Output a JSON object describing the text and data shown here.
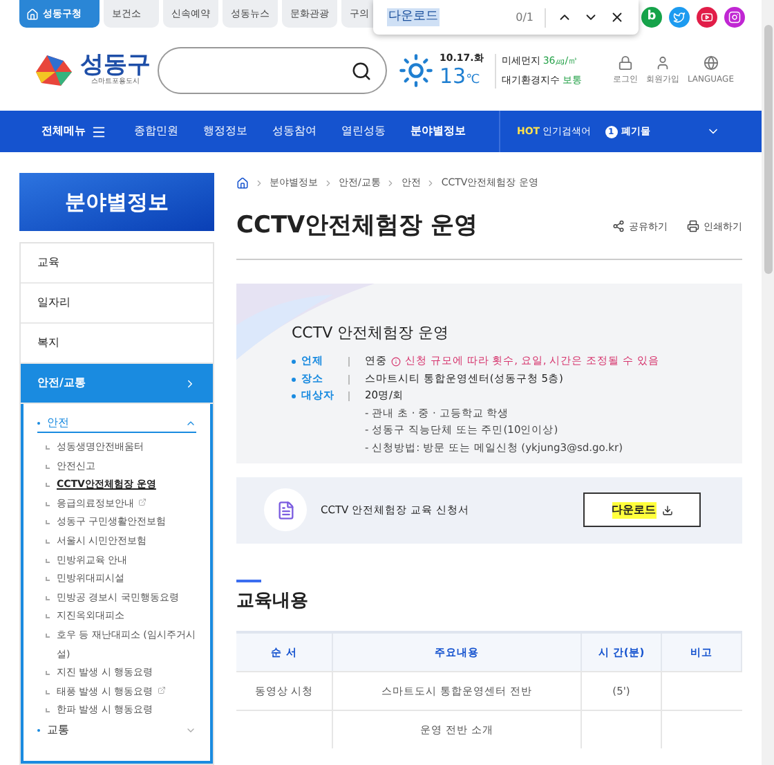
{
  "top_tabs": [
    {
      "label": "성동구청",
      "selected": true
    },
    {
      "label": "보건소",
      "selected": false
    },
    {
      "label": "신속예약",
      "selected": false
    },
    {
      "label": "성동뉴스",
      "selected": false
    },
    {
      "label": "문화관광",
      "selected": false
    },
    {
      "label": "구의",
      "selected": false
    }
  ],
  "find_bar": {
    "value": "다운로드",
    "count": "0/1"
  },
  "social": [
    {
      "kind": "blog",
      "label": "b",
      "color": "#16a34a"
    },
    {
      "kind": "twitter",
      "color": "#1d9bf0"
    },
    {
      "kind": "youtube",
      "color": "#e11d48"
    },
    {
      "kind": "instagram",
      "color": "#c026d3"
    }
  ],
  "header": {
    "logo": "성동구",
    "slogan": "스마트포용도시",
    "date": "10.17.화",
    "temp": "13",
    "unit": "℃",
    "dust_label": "미세먼지",
    "dust_value": "36㎍/㎥",
    "air_label": "대기환경지수",
    "air_value": "보통",
    "utils": [
      {
        "kind": "lock",
        "label": "로그인"
      },
      {
        "kind": "user",
        "label": "회원가입"
      },
      {
        "kind": "globe",
        "label": "LANGUAGE"
      }
    ]
  },
  "nav": {
    "all_menu": "전체메뉴",
    "items": [
      {
        "label": "종합민원",
        "selected": false
      },
      {
        "label": "행정정보",
        "selected": false
      },
      {
        "label": "성동참여",
        "selected": false
      },
      {
        "label": "열린성동",
        "selected": false
      },
      {
        "label": "분야별정보",
        "selected": true
      }
    ],
    "hot": "HOT",
    "hot_label": "인기검색어",
    "rank": "1",
    "keyword": "폐기물"
  },
  "sidebar": {
    "title": "분야별정보",
    "items": [
      {
        "label": "교육",
        "selected": false
      },
      {
        "label": "일자리",
        "selected": false
      },
      {
        "label": "복지",
        "selected": false
      },
      {
        "label": "안전/교통",
        "selected": true
      }
    ],
    "groups": [
      {
        "label": "안전",
        "expanded": true,
        "children": [
          {
            "label": "성동생명안전배움터",
            "selected": false,
            "external": false
          },
          {
            "label": "안전신고",
            "selected": false,
            "external": false
          },
          {
            "label": "CCTV안전체험장 운영",
            "selected": true,
            "external": false
          },
          {
            "label": "응급의료정보안내",
            "selected": false,
            "external": true
          },
          {
            "label": "성동구 구민생활안전보험",
            "selected": false,
            "external": false
          },
          {
            "label": "서울시 시민안전보험",
            "selected": false,
            "external": false
          },
          {
            "label": "민방위교육 안내",
            "selected": false,
            "external": false
          },
          {
            "label": "민방위대피시설",
            "selected": false,
            "external": false
          },
          {
            "label": "민방공 경보시 국민행동요령",
            "selected": false,
            "external": false
          },
          {
            "label": "지진옥외대피소",
            "selected": false,
            "external": false
          },
          {
            "label": "호우 등 재난대피소 (임시주거시설)",
            "selected": false,
            "external": false
          },
          {
            "label": "지진 발생 시 행동요령",
            "selected": false,
            "external": false
          },
          {
            "label": "태풍 발생 시 행동요령",
            "selected": false,
            "external": true
          },
          {
            "label": "한파 발생 시 행동요령",
            "selected": false,
            "external": false
          }
        ]
      },
      {
        "label": "교통",
        "expanded": false
      }
    ]
  },
  "breadcrumb": [
    "분야별정보",
    "안전/교통",
    "안전",
    "CCTV안전체험장 운영"
  ],
  "page_title": "CCTV안전체험장 운영",
  "actions": [
    {
      "kind": "share",
      "label": "공유하기"
    },
    {
      "kind": "print",
      "label": "인쇄하기"
    }
  ],
  "info": {
    "title": "CCTV 안전체험장 운영",
    "rows": [
      {
        "label": "언제",
        "value": "연중",
        "note": "신청 규모에 따라 횟수, 요일, 시간은 조정될 수 있음"
      },
      {
        "label": "장소",
        "value": "스마트시티 통합운영센터(성동구청 5층)"
      },
      {
        "label": "대상자",
        "value": "20명/회",
        "lines": [
          "- 관내 초 · 중 · 고등학교 학생",
          "- 성동구 직능단체 또는 주민(10인이상)",
          "- 신청방법: 방문 또는 메일신청 (ykjung3@sd.go.kr)"
        ]
      }
    ]
  },
  "download": {
    "file": "CCTV 안전체험장 교육 신청서",
    "button": "다운로드"
  },
  "section": "교육내용",
  "table": {
    "columns": [
      "순 서",
      "주요내용",
      "시 간(분)",
      "비고"
    ],
    "rows": [
      [
        "동영상 시청",
        "스마트도시 통합운영센터 전반",
        "(5')"
      ],
      [
        null,
        "운영 전반 소개",
        null
      ]
    ]
  }
}
